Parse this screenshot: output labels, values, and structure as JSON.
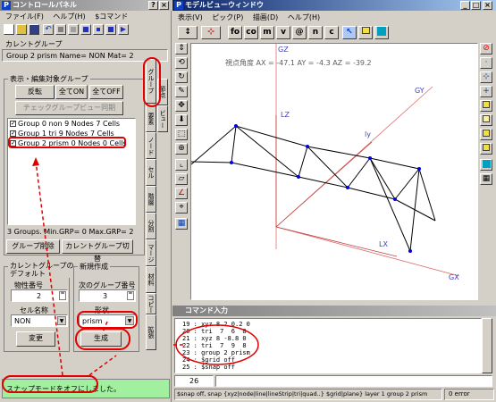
{
  "control_panel": {
    "title": "コントロールパネル",
    "menu": [
      "ファイル(F)",
      "ヘルプ(H)",
      "$コマンド"
    ],
    "current_group_label": "カレントグループ",
    "current_group_info": "Group 2 prism Name= NON Mat= 2",
    "display_group_label": "表示・編集対象グループ",
    "btn_reverse": "反転",
    "btn_all_on": "全てON",
    "btn_all_off": "全てOFF",
    "btn_check_sync": "チェックグループビュー同期",
    "groups": [
      {
        "label": "Group 0 non  9 Nodes 7 Cells",
        "checked": true
      },
      {
        "label": "Group 1 tri  9 Nodes 7 Cells",
        "checked": true
      },
      {
        "label": "Group 2 prism  0 Nodes 0 Cells",
        "checked": true
      }
    ],
    "groups_summary": "3 Groups. Min.GRP= 0 Max.GRP= 2",
    "btn_delete_group": "グループ削除",
    "btn_switch_current": "カレントグループ切替",
    "default_label": "カレントグループの\nデフォルト",
    "material_label": "物性番号",
    "material_value": "2",
    "section_label": "セル名称",
    "section_value": "NON",
    "btn_change": "変更",
    "new_create_label": "新規作成",
    "next_group_label": "次のグループ番号",
    "next_group_value": "3",
    "shape_label": "形状",
    "shape_value": "prism",
    "btn_create": "生成",
    "tabs": [
      "グループ",
      "節点",
      "要素",
      "ビュー",
      "ノード",
      "セル",
      "階層",
      "分割",
      "マージ",
      "材料",
      "コピー",
      "拡張"
    ],
    "status": "スナップモードをオフにしました。"
  },
  "model_view": {
    "title": "モデルビューウィンドウ",
    "menu": [
      "表示(V)",
      "ピック(P)",
      "描画(D)",
      "ヘルプ(H)"
    ],
    "toolbar_labels": [
      "fo",
      "co",
      "m",
      "v",
      "@",
      "n",
      "c"
    ],
    "view_angle": "視点角度  AX = -47.1   AY = -4.3   AZ = -39.2",
    "axis_labels": {
      "gz": "GZ",
      "gx": "GX",
      "gy": "GY",
      "lz": "LZ",
      "ly": "ly",
      "lx": "LX"
    }
  },
  "command_window": {
    "title": "コマンド入力",
    "lines": [
      "19 : xyz 8.2 0.2 0",
      "20 : tri  7  6  8",
      "21 : xyz 8 -8.8 0",
      "22 : tri  7  9  8",
      "23 : group 2 prism",
      "24 : $grid off",
      "25 : $snap off"
    ],
    "input_number": "26",
    "status_bar": "$snap off, snap {xyz|node|line|lineStrip|tri|quad..} $grid|plane}  layer 1 group 2 prism",
    "error_count": "0 error"
  }
}
